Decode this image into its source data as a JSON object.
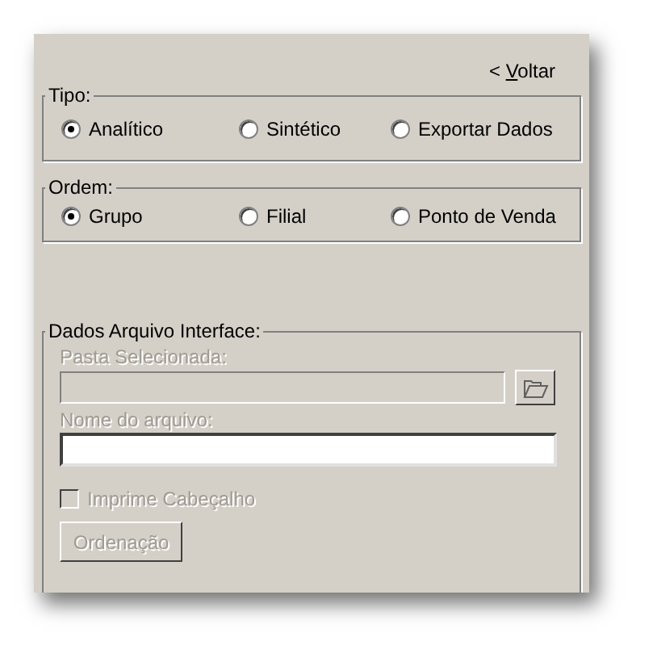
{
  "back_link": {
    "arrow": "<",
    "label": "Voltar"
  },
  "groups": [
    {
      "title": "Tipo:",
      "options": [
        {
          "label": "Analítico",
          "selected": true
        },
        {
          "label": "Sintético",
          "selected": false
        },
        {
          "label": "Exportar Dados",
          "selected": false
        }
      ]
    },
    {
      "title": "Ordem:",
      "options": [
        {
          "label": "Grupo",
          "selected": true
        },
        {
          "label": "Filial",
          "selected": false
        },
        {
          "label": "Ponto de Venda",
          "selected": false
        }
      ]
    }
  ],
  "interface_group": {
    "title": "Dados Arquivo Interface:",
    "folder_field": {
      "label": "Pasta Selecionada:",
      "disabled": true
    },
    "file_field": {
      "label": "Nome do arquivo:",
      "label_disabled": true,
      "disabled": false
    },
    "header_checkbox": {
      "label": "Imprime Cabeçalho",
      "checked": false,
      "disabled": true
    },
    "sort_button": {
      "label": "Ordenação",
      "disabled": true
    }
  }
}
